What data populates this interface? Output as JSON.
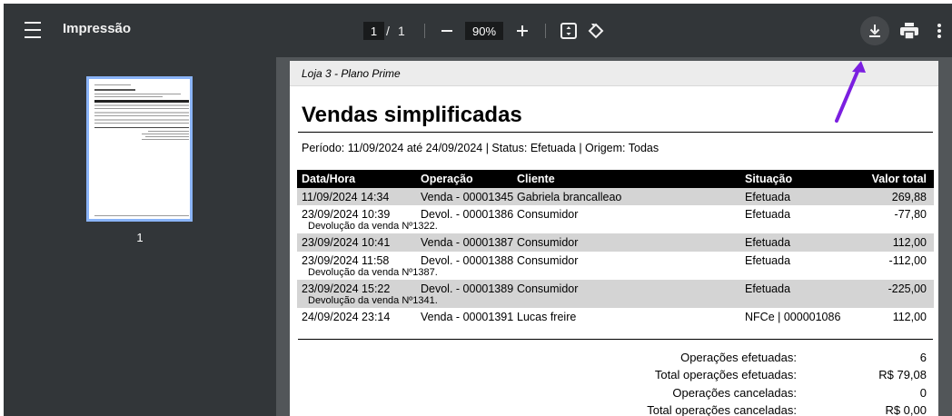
{
  "toolbar": {
    "title": "Impressão",
    "current_page": "1",
    "page_separator": "/",
    "total_pages": "1",
    "zoom": "90%"
  },
  "sidebar": {
    "thumbnail_page_number": "1"
  },
  "document": {
    "store": "Loja 3 - Plano Prime",
    "title": "Vendas simplificadas",
    "period": "Período: 11/09/2024 até 24/09/2024 | Status: Efetuada | Origem: Todas",
    "columns": [
      "Data/Hora",
      "Operação",
      "Cliente",
      "Situação",
      "Valor total"
    ],
    "rows": [
      {
        "date": "11/09/2024 14:34",
        "operation": "Venda - 00001345",
        "client": "Gabriela brancalleao",
        "status": "Efetuada",
        "value": "269,88",
        "note": ""
      },
      {
        "date": "23/09/2024 10:39",
        "operation": "Devol. - 00001386",
        "client": "Consumidor",
        "status": "Efetuada",
        "value": "-77,80",
        "note": "Devolução da venda Nº1322."
      },
      {
        "date": "23/09/2024 10:41",
        "operation": "Venda - 00001387",
        "client": "Consumidor",
        "status": "Efetuada",
        "value": "112,00",
        "note": ""
      },
      {
        "date": "23/09/2024 11:58",
        "operation": "Devol. - 00001388",
        "client": "Consumidor",
        "status": "Efetuada",
        "value": "-112,00",
        "note": "Devolução da venda Nº1387."
      },
      {
        "date": "23/09/2024 15:22",
        "operation": "Devol. - 00001389",
        "client": "Consumidor",
        "status": "Efetuada",
        "value": "-225,00",
        "note": "Devolução da venda Nº1341."
      },
      {
        "date": "24/09/2024 23:14",
        "operation": "Venda - 00001391",
        "client": "Lucas freire",
        "status": "NFCe | 000001086",
        "value": "112,00",
        "note": ""
      }
    ],
    "summary": [
      {
        "label": "Operações efetuadas:",
        "value": "6"
      },
      {
        "label": "Total operações efetuadas:",
        "value": "R$ 79,08"
      },
      {
        "label": "Operações canceladas:",
        "value": "0"
      },
      {
        "label": "Total operações canceladas:",
        "value": "R$ 0,00"
      }
    ]
  },
  "icons": {
    "menu": "hamburger-icon",
    "zoom_out": "minus-icon",
    "zoom_in": "plus-icon",
    "fit": "fit-to-page-icon",
    "rotate": "rotate-icon",
    "download": "download-icon",
    "print": "printer-icon",
    "more": "more-vertical-icon"
  },
  "colors": {
    "toolbar": "#323639",
    "viewer_bg": "#525659",
    "thumb_border": "#8ab4f8",
    "annotation_arrow": "#7b1fe0",
    "table_header": "#000000",
    "row_shade": "#d4d4d4"
  }
}
